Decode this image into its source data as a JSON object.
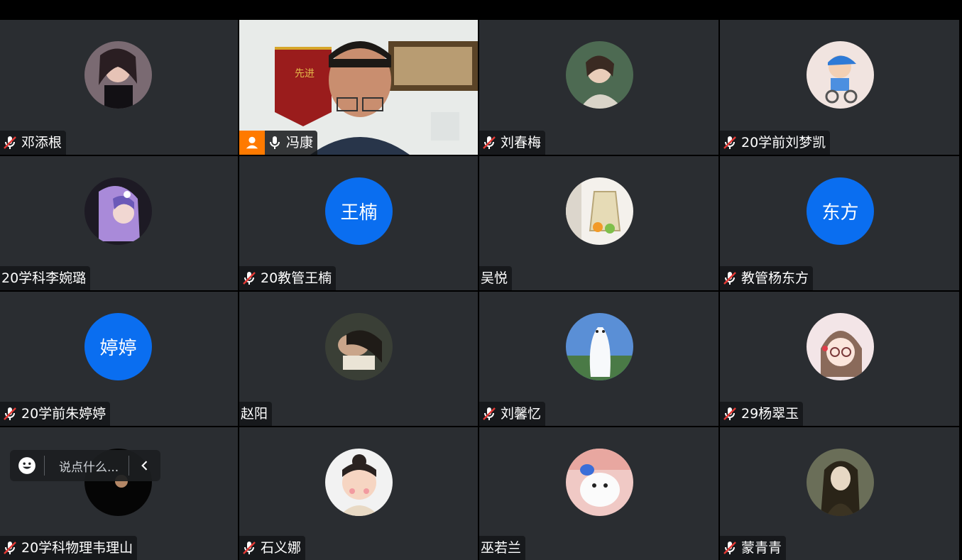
{
  "chat": {
    "placeholder": "说点什么..."
  },
  "participants": [
    {
      "name": "邓添根",
      "muted": true,
      "avatar": "photo-dark-girl-avatar"
    },
    {
      "name": "冯康",
      "muted": false,
      "video": true,
      "host": true
    },
    {
      "name": "刘春梅",
      "muted": true,
      "avatar": "photo-woman-green-avatar"
    },
    {
      "name": "20学前刘梦凯",
      "muted": true,
      "avatar": "cartoon-boy-cap-avatar"
    },
    {
      "name": "20学科李婉璐",
      "muted": false,
      "avatar": "anime-girl-avatar"
    },
    {
      "name": "20教管王楠",
      "muted": true,
      "avatar_text": "王楠"
    },
    {
      "name": "吴悦",
      "muted": false,
      "avatar": "photo-fruit-bag-avatar"
    },
    {
      "name": "教管杨东方",
      "muted": true,
      "avatar_text": "东方"
    },
    {
      "name": "20学前朱婷婷",
      "muted": true,
      "avatar_text": "婷婷"
    },
    {
      "name": "赵阳",
      "muted": false,
      "avatar": "photo-reading-avatar"
    },
    {
      "name": "刘馨忆",
      "muted": true,
      "avatar": "cat-cloud-avatar"
    },
    {
      "name": "29杨翠玉",
      "muted": true,
      "avatar": "cartoon-girl-pink-avatar"
    },
    {
      "name": "20学科物理韦理山",
      "muted": true,
      "avatar": "dark-face-avatar"
    },
    {
      "name": "石义娜",
      "muted": true,
      "avatar": "baby-photo-avatar"
    },
    {
      "name": "巫若兰",
      "muted": false,
      "avatar": "dog-photo-avatar"
    },
    {
      "name": "蒙青青",
      "muted": true,
      "avatar": "mona-lisa-avatar"
    }
  ],
  "colors": {
    "tile": "#2a2d31",
    "text_avatar": "#0a6ef0",
    "active_border": "#1fbd53",
    "host_badge": "#ff7a00",
    "mute_slash": "#e53935"
  }
}
